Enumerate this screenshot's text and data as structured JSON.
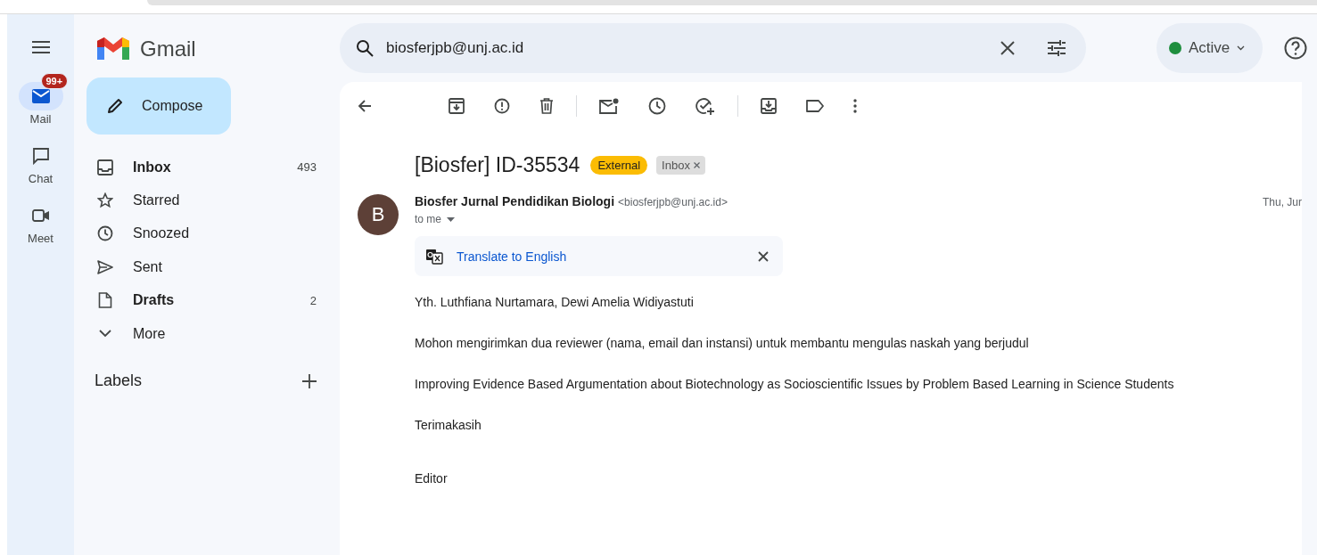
{
  "rail": {
    "items": [
      {
        "label": "Mail",
        "kind": "mail",
        "selected": true,
        "badge": "99+"
      },
      {
        "label": "Chat",
        "kind": "chat",
        "selected": false
      },
      {
        "label": "Meet",
        "kind": "meet",
        "selected": false
      }
    ]
  },
  "app": {
    "name": "Gmail"
  },
  "compose": {
    "label": "Compose"
  },
  "folders": [
    {
      "label": "Inbox",
      "kind": "inbox",
      "count": "493",
      "unread": true
    },
    {
      "label": "Starred",
      "kind": "starred",
      "unread": false
    },
    {
      "label": "Snoozed",
      "kind": "snoozed",
      "unread": false
    },
    {
      "label": "Sent",
      "kind": "sent",
      "unread": false
    },
    {
      "label": "Drafts",
      "kind": "drafts",
      "count": "2",
      "unread": true
    },
    {
      "label": "More",
      "kind": "more",
      "unread": false
    }
  ],
  "labels": {
    "heading": "Labels"
  },
  "search": {
    "value": "biosferjpb@unj.ac.id"
  },
  "status": {
    "label": "Active"
  },
  "email": {
    "subject": "[Biosfer] ID-35534",
    "tags": [
      {
        "label": "External",
        "kind": "external",
        "removable": false
      },
      {
        "label": "Inbox",
        "kind": "label",
        "removable": true
      }
    ],
    "sender": {
      "initial": "B",
      "name": "Biosfer Jurnal Pendidikan Biologi",
      "address": "<biosferjpb@unj.ac.id>",
      "recipient": "to me",
      "date": "Thu, Jur"
    },
    "translate": {
      "link": "Translate to English"
    },
    "body": [
      {
        "text": "Yth. Luthfiana Nurtamara, Dewi Amelia Widiyastuti",
        "kind": "paragraph"
      },
      {
        "text": "Mohon mengirimkan dua reviewer (nama, email dan instansi) untuk membantu mengulas naskah yang berjudul",
        "kind": "paragraph"
      },
      {
        "text": "Improving Evidence Based Argumentation about Biotechnology as Socioscientific Issues by Problem Based Learning in Science Students",
        "kind": "paragraph"
      },
      {
        "text": "Terimakasih",
        "kind": "paragraph"
      },
      {
        "text": "Editor",
        "kind": "signature"
      }
    ]
  }
}
